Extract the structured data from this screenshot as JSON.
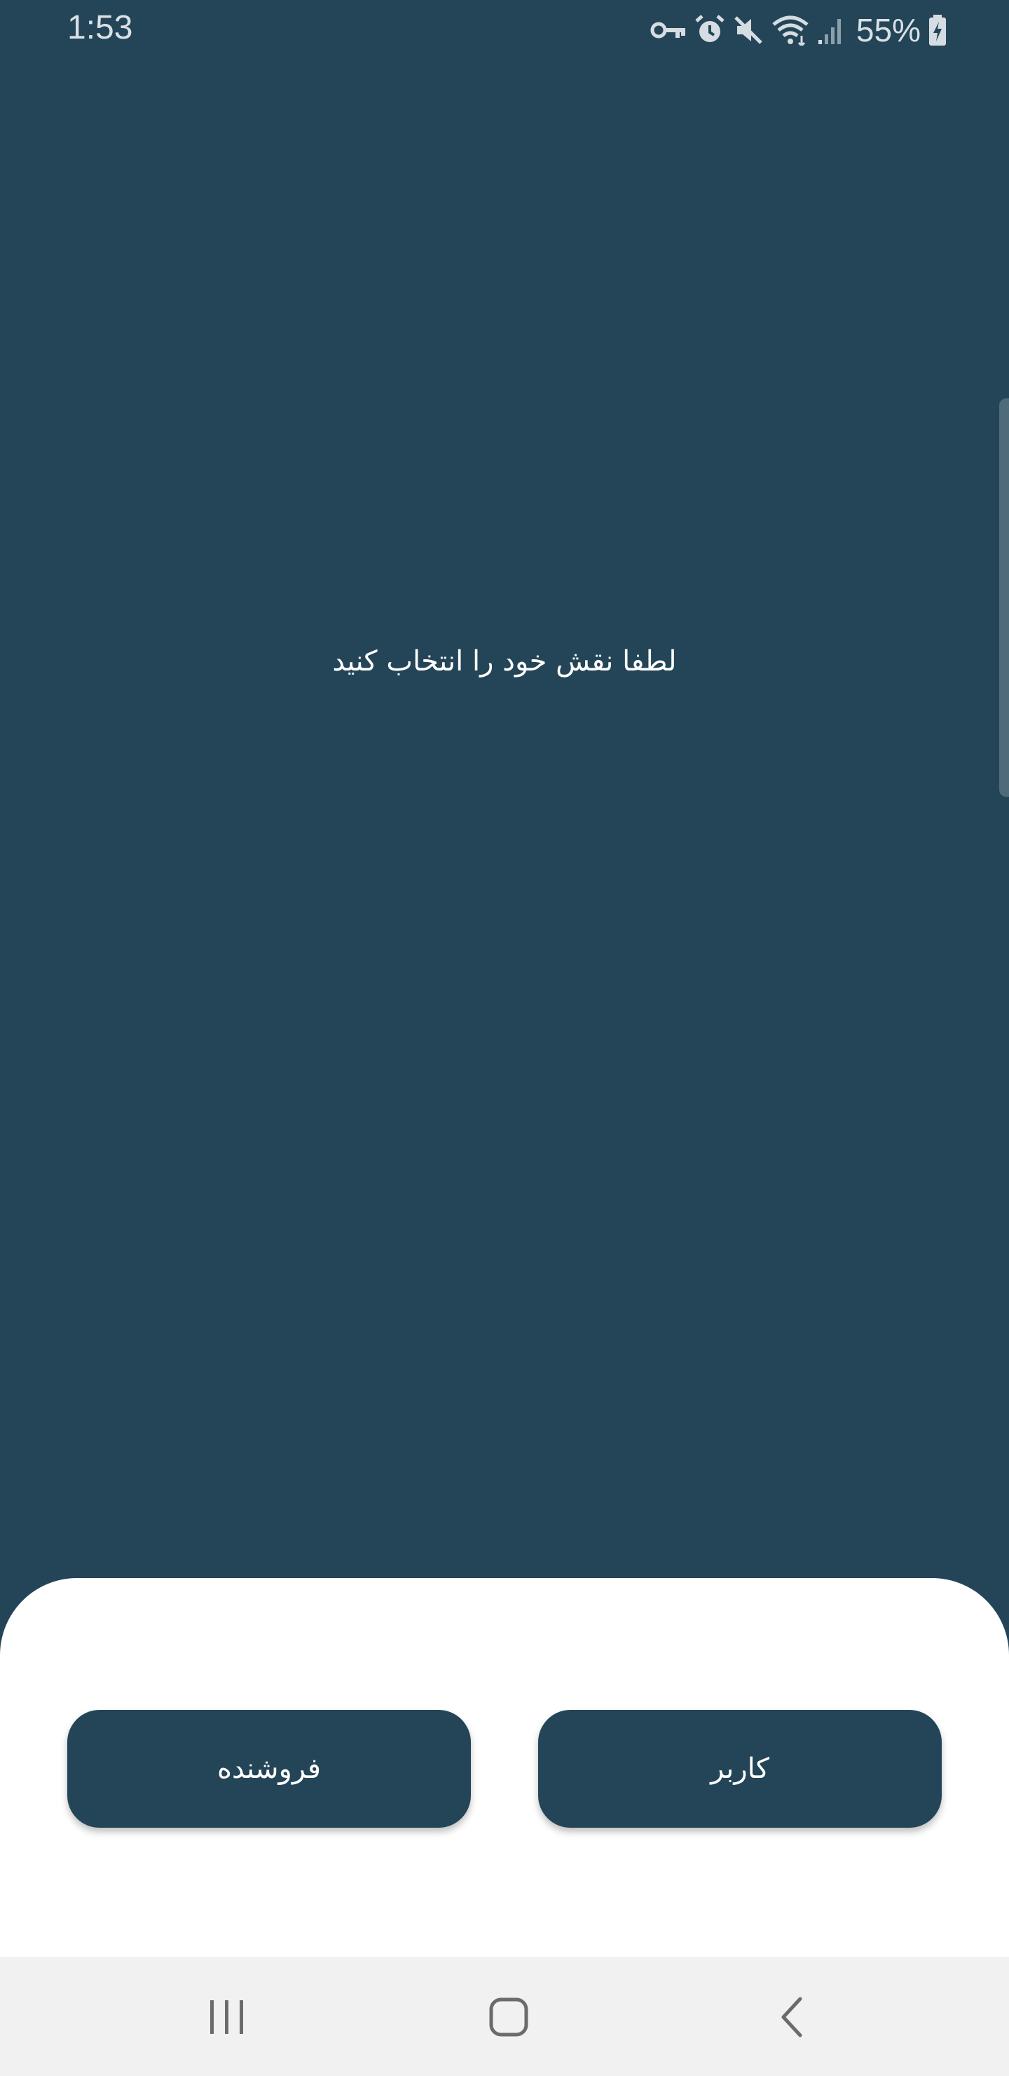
{
  "status_bar": {
    "time": "1:53",
    "battery": "55%",
    "icons": [
      "vpn-key-icon",
      "alarm-icon",
      "mute-icon",
      "wifi-icon",
      "signal-icon",
      "battery-charging-icon"
    ]
  },
  "main": {
    "prompt": "لطفا نقش خود را انتخاب کنید"
  },
  "sheet": {
    "seller_label": "فروشنده",
    "user_label": "کاربر"
  },
  "nav_bar": {
    "icons": [
      "recent-apps-icon",
      "home-icon",
      "back-icon"
    ]
  },
  "colors": {
    "background": "#244557",
    "sheet": "#ffffff",
    "button": "#244557",
    "nav_bar": "#f1f1f1"
  }
}
